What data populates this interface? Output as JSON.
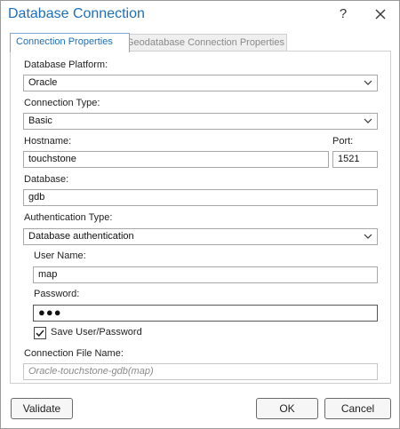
{
  "window": {
    "title": "Database Connection"
  },
  "icons": {
    "help": "?",
    "close": "close-icon"
  },
  "tabs": [
    {
      "label": "Connection Properties",
      "active": true
    },
    {
      "label": "Geodatabase Connection Properties",
      "active": false
    }
  ],
  "form": {
    "platform": {
      "label": "Database Platform:",
      "value": "Oracle"
    },
    "connection_type": {
      "label": "Connection Type:",
      "value": "Basic"
    },
    "hostname": {
      "label": "Hostname:",
      "value": "touchstone"
    },
    "port": {
      "label": "Port:",
      "value": "1521"
    },
    "database": {
      "label": "Database:",
      "value": "gdb"
    },
    "auth_type": {
      "label": "Authentication Type:",
      "value": "Database authentication"
    },
    "username": {
      "label": "User Name:",
      "value": "map"
    },
    "password": {
      "label": "Password:",
      "value": "●●●"
    },
    "save_user": {
      "label": "Save User/Password",
      "checked": true
    },
    "file_name": {
      "label": "Connection File Name:",
      "value": "Oracle-touchstone-gdb(map)"
    }
  },
  "buttons": {
    "validate": "Validate",
    "ok": "OK",
    "cancel": "Cancel"
  }
}
